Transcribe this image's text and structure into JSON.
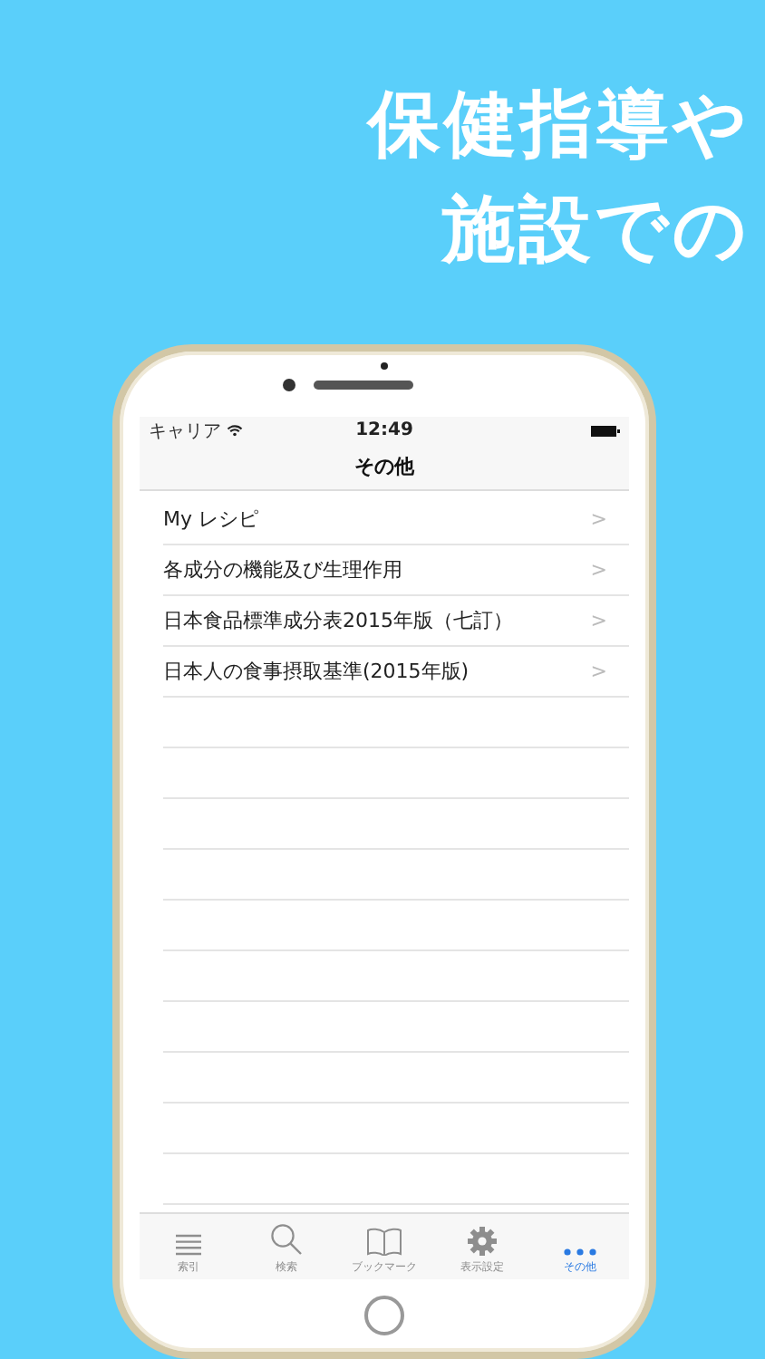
{
  "headline": [
    "保健指導や",
    "施設での"
  ],
  "status_bar": {
    "carrier": "キャリア",
    "time": "12:49"
  },
  "nav_title": "その他",
  "items": [
    {
      "label": "My レシピ",
      "chevron": ">"
    },
    {
      "label": "各成分の機能及び生理作用",
      "chevron": ">"
    },
    {
      "label": "日本食品標準成分表2015年版（七訂）",
      "chevron": ">"
    },
    {
      "label": "日本人の食事摂取基準(2015年版)",
      "chevron": ">"
    }
  ],
  "tabs": [
    {
      "label": "索引",
      "selected": false
    },
    {
      "label": "検索",
      "selected": false
    },
    {
      "label": "ブックマーク",
      "selected": false
    },
    {
      "label": "表示設定",
      "selected": false
    },
    {
      "label": "その他",
      "selected": true
    }
  ]
}
